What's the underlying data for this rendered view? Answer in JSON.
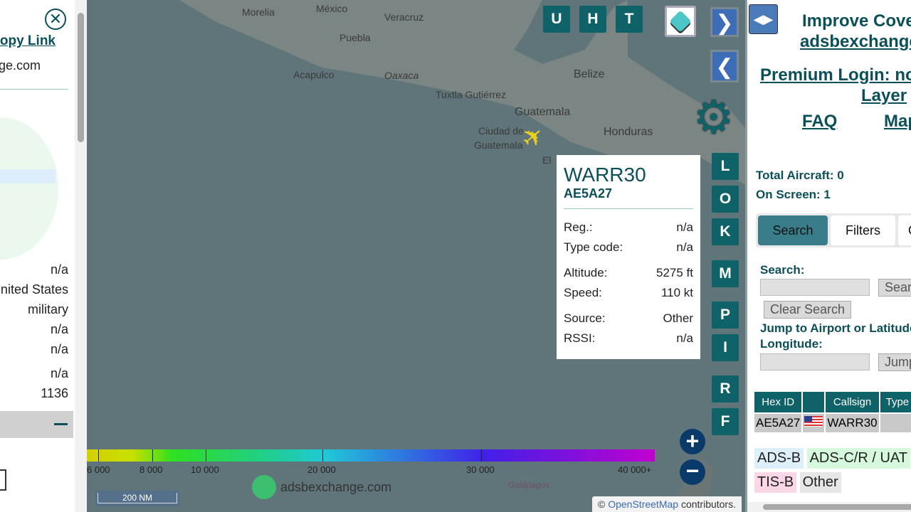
{
  "left_panel": {
    "copy_link": "Copy Link",
    "domain_fragment": "ge.com",
    "values": [
      "n/a",
      "United States",
      "military",
      "n/a",
      "n/a",
      "n/a",
      "1136"
    ],
    "collapse_icon": "minus-icon",
    "close_icon": "close-circle-icon"
  },
  "map": {
    "labels": [
      "Morelia",
      "México",
      "Veracruz",
      "Puebla",
      "Acapulco",
      "Oaxaca",
      "Tuxtla Gutiérrez",
      "Belize",
      "Guatemala",
      "Ciudad de",
      "Guatemala",
      "Honduras",
      "El",
      "Galápagos"
    ],
    "top_buttons": [
      "U",
      "H",
      "T"
    ],
    "side_buttons": [
      "L",
      "O",
      "K",
      "M",
      "P",
      "I",
      "R",
      "F"
    ],
    "altitude_legend": {
      "ticks": [
        "6 000",
        "8 000",
        "10 000",
        "20 000",
        "30 000",
        "40 000+"
      ],
      "colors": [
        "#d4d000",
        "#c8e000",
        "#30e020",
        "#20d080",
        "#20c8d8",
        "#4020e8",
        "#c000d0"
      ]
    },
    "logo_text": "adsbexchange.com",
    "scale": "200 NM",
    "attribution_prefix": "©",
    "attribution_link": "OpenStreetMap",
    "attribution_suffix": "contributors.",
    "aircraft_color": "#e8d020"
  },
  "popup": {
    "callsign": "WARR30",
    "hex": "AE5A27",
    "rows": [
      {
        "label": "Reg.:",
        "value": "n/a"
      },
      {
        "label": "Type code:",
        "value": "n/a"
      },
      {
        "label": "Altitude:",
        "value": "5275 ft"
      },
      {
        "label": "Speed:",
        "value": "110 kt"
      },
      {
        "label": "Source:",
        "value": "Other"
      },
      {
        "label": "RSSI:",
        "value": "n/a"
      }
    ]
  },
  "right_panel": {
    "improve_line1": "Improve Coverage",
    "improve_line2": "adsbexchange.com",
    "premium_line1": "Premium Login: no ads",
    "premium_line2": "Layer",
    "faq": "FAQ",
    "map_link": "Map",
    "total_aircraft": "Total Aircraft: 0",
    "on_screen": "On Screen: 1",
    "tabs": [
      "Search",
      "Filters",
      "Other"
    ],
    "search_label": "Search:",
    "search_button": "Search",
    "clear_search": "Clear Search",
    "jump_label_1": "Jump to Airport or Latitude,",
    "jump_label_2": "Longitude:",
    "jump_button": "Jump",
    "table_headers": [
      "Hex ID",
      "",
      "Callsign",
      "Type"
    ],
    "table_rows": [
      {
        "hex": "AE5A27",
        "flag": "us-flag-icon",
        "callsign": "WARR30",
        "type": ""
      }
    ],
    "legend": [
      "ADS-B",
      "ADS-C/R / UAT",
      "TIS-B",
      "Other"
    ]
  }
}
